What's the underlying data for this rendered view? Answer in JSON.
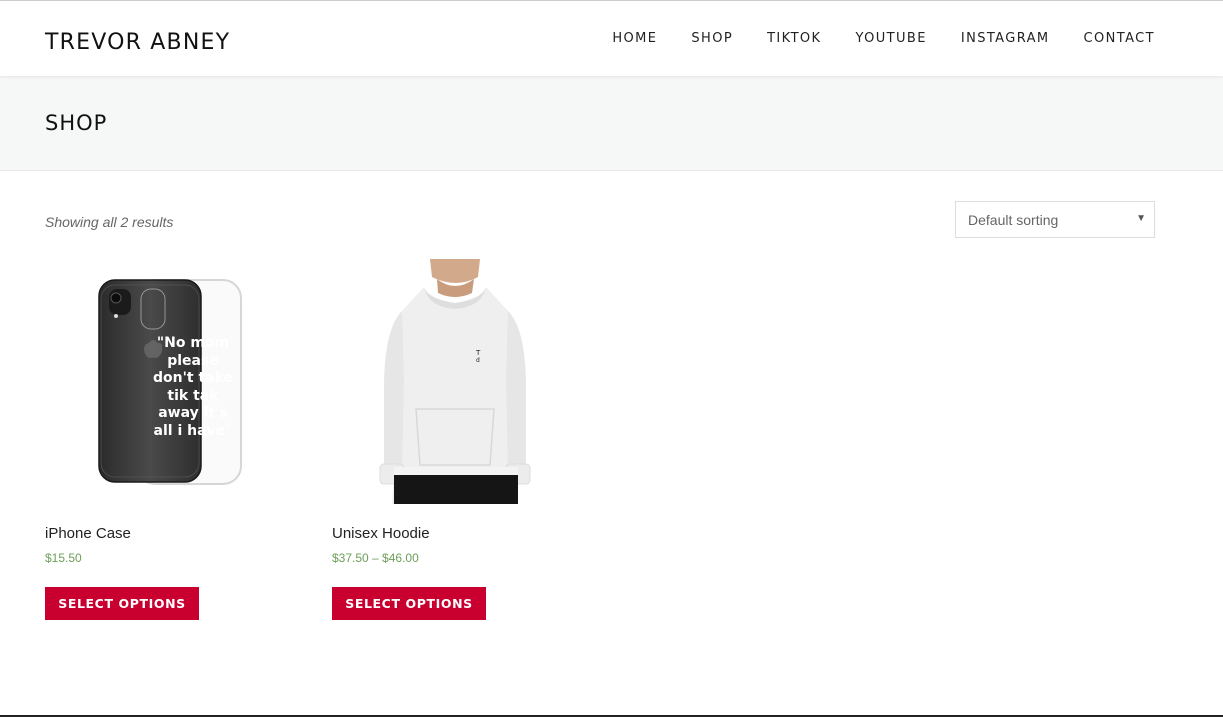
{
  "site": {
    "logo": "TREVOR ABNEY"
  },
  "nav": {
    "items": [
      {
        "label": "HOME",
        "name": "nav-home"
      },
      {
        "label": "SHOP",
        "name": "nav-shop"
      },
      {
        "label": "TIKTOK",
        "name": "nav-tiktok"
      },
      {
        "label": "YOUTUBE",
        "name": "nav-youtube"
      },
      {
        "label": "INSTAGRAM",
        "name": "nav-instagram"
      },
      {
        "label": "CONTACT",
        "name": "nav-contact"
      }
    ]
  },
  "page": {
    "title": "SHOP"
  },
  "shop": {
    "result_count": "Showing all 2 results",
    "sorting": {
      "selected": "Default sorting"
    }
  },
  "products": [
    {
      "name": "iPhone Case",
      "price": "$15.50",
      "button": "SELECT OPTIONS",
      "image_text": [
        "\"No mom",
        "please",
        "don't take",
        "tik tak",
        "away it's",
        "all i have\""
      ]
    },
    {
      "name": "Unisex Hoodie",
      "price": "$37.50 – $46.00",
      "button": "SELECT OPTIONS"
    }
  ],
  "colors": {
    "accent": "#c9002f",
    "price": "#6c9f5a",
    "title_bar": "#f6f7f7"
  }
}
